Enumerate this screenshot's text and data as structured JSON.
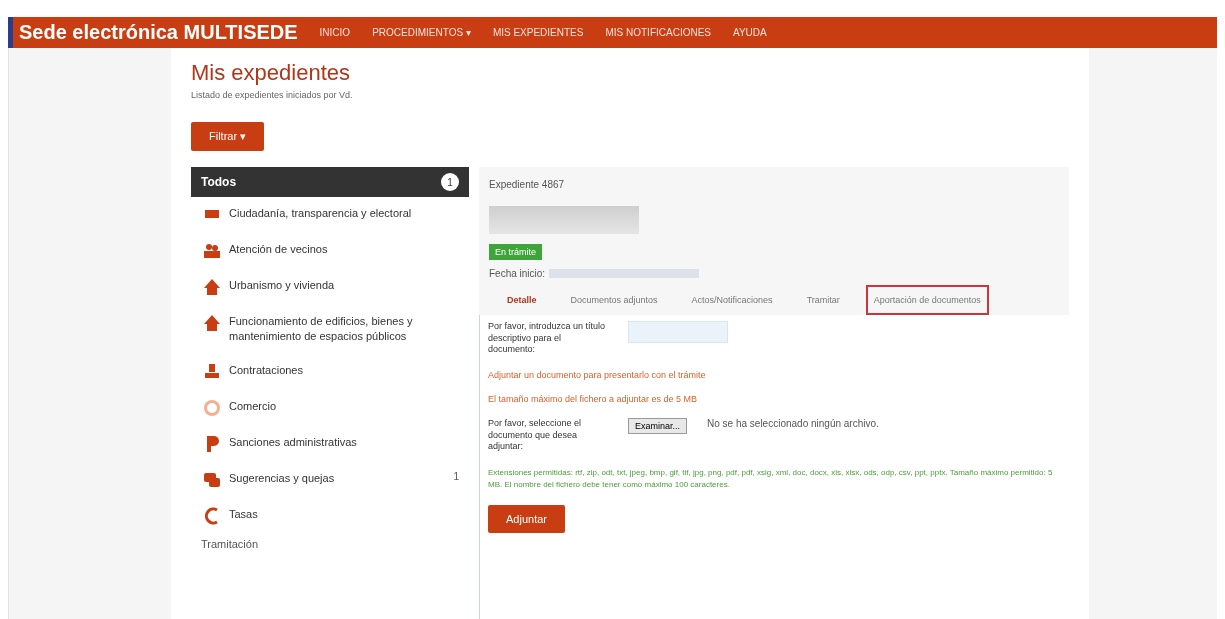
{
  "header": {
    "title": "Sede electrónica MULTISEDE",
    "nav": [
      "INICIO",
      "PROCEDIMIENTOS ▾",
      "MIS EXPEDIENTES",
      "MIS NOTIFICACIONES",
      "AYUDA"
    ]
  },
  "page": {
    "title": "Mis expedientes",
    "subtitle": "Listado de expedientes iniciados por Vd.",
    "filter_button": "Filtrar ▾"
  },
  "sidebar": {
    "header": {
      "label": "Todos",
      "badge": "1"
    },
    "items": [
      {
        "label": "Ciudadanía, transparencia y electoral"
      },
      {
        "label": "Atención de vecinos"
      },
      {
        "label": "Urbanismo y vivienda"
      },
      {
        "label": "Funcionamiento de edificios, bienes y mantenimiento de espacios públicos"
      },
      {
        "label": "Contrataciones"
      },
      {
        "label": "Comercio"
      },
      {
        "label": "Sanciones administrativas"
      },
      {
        "label": "Sugerencias y quejas",
        "count": "1"
      },
      {
        "label": "Tasas"
      }
    ],
    "footer": "Tramitación"
  },
  "detail": {
    "title": "Expediente 4867",
    "status": "En trámite",
    "date_label": "Fecha inicio:",
    "tabs": [
      {
        "label": "Detalle",
        "selected": true
      },
      {
        "label": "Documentos adjuntos",
        "selected": false
      },
      {
        "label": "Actos/Notificaciones",
        "selected": false
      },
      {
        "label": "Tramitar",
        "selected": false
      },
      {
        "label": "Aportación de documentos",
        "selected": false,
        "highlighted": true
      }
    ],
    "form": {
      "title_label": "Por favor, introduzca un título descriptivo para el documento:",
      "attach_note": "Adjuntar un documento para presentarlo con el trámite",
      "size_note": "El tamaño máximo del fichero a adjuntar es de 5 MB",
      "file_label": "Por favor, seleccione el documento que desea adjuntar:",
      "browse_button": "Examinar...",
      "no_file": "No se ha seleccionado ningún archivo.",
      "extensions": "Extensiones permitidas: rtf, zip, odt, txt, jpeg, bmp, gif, tif, jpg, png, pdf, pdf, xsig, xml, doc, docx, xls, xlsx, ods, odp, csv, ppt, pptx. Tamaño máximo permitido: 5 MB. El nombre del fichero debe tener como máximo 100 caracteres.",
      "submit_button": "Adjuntar"
    }
  }
}
